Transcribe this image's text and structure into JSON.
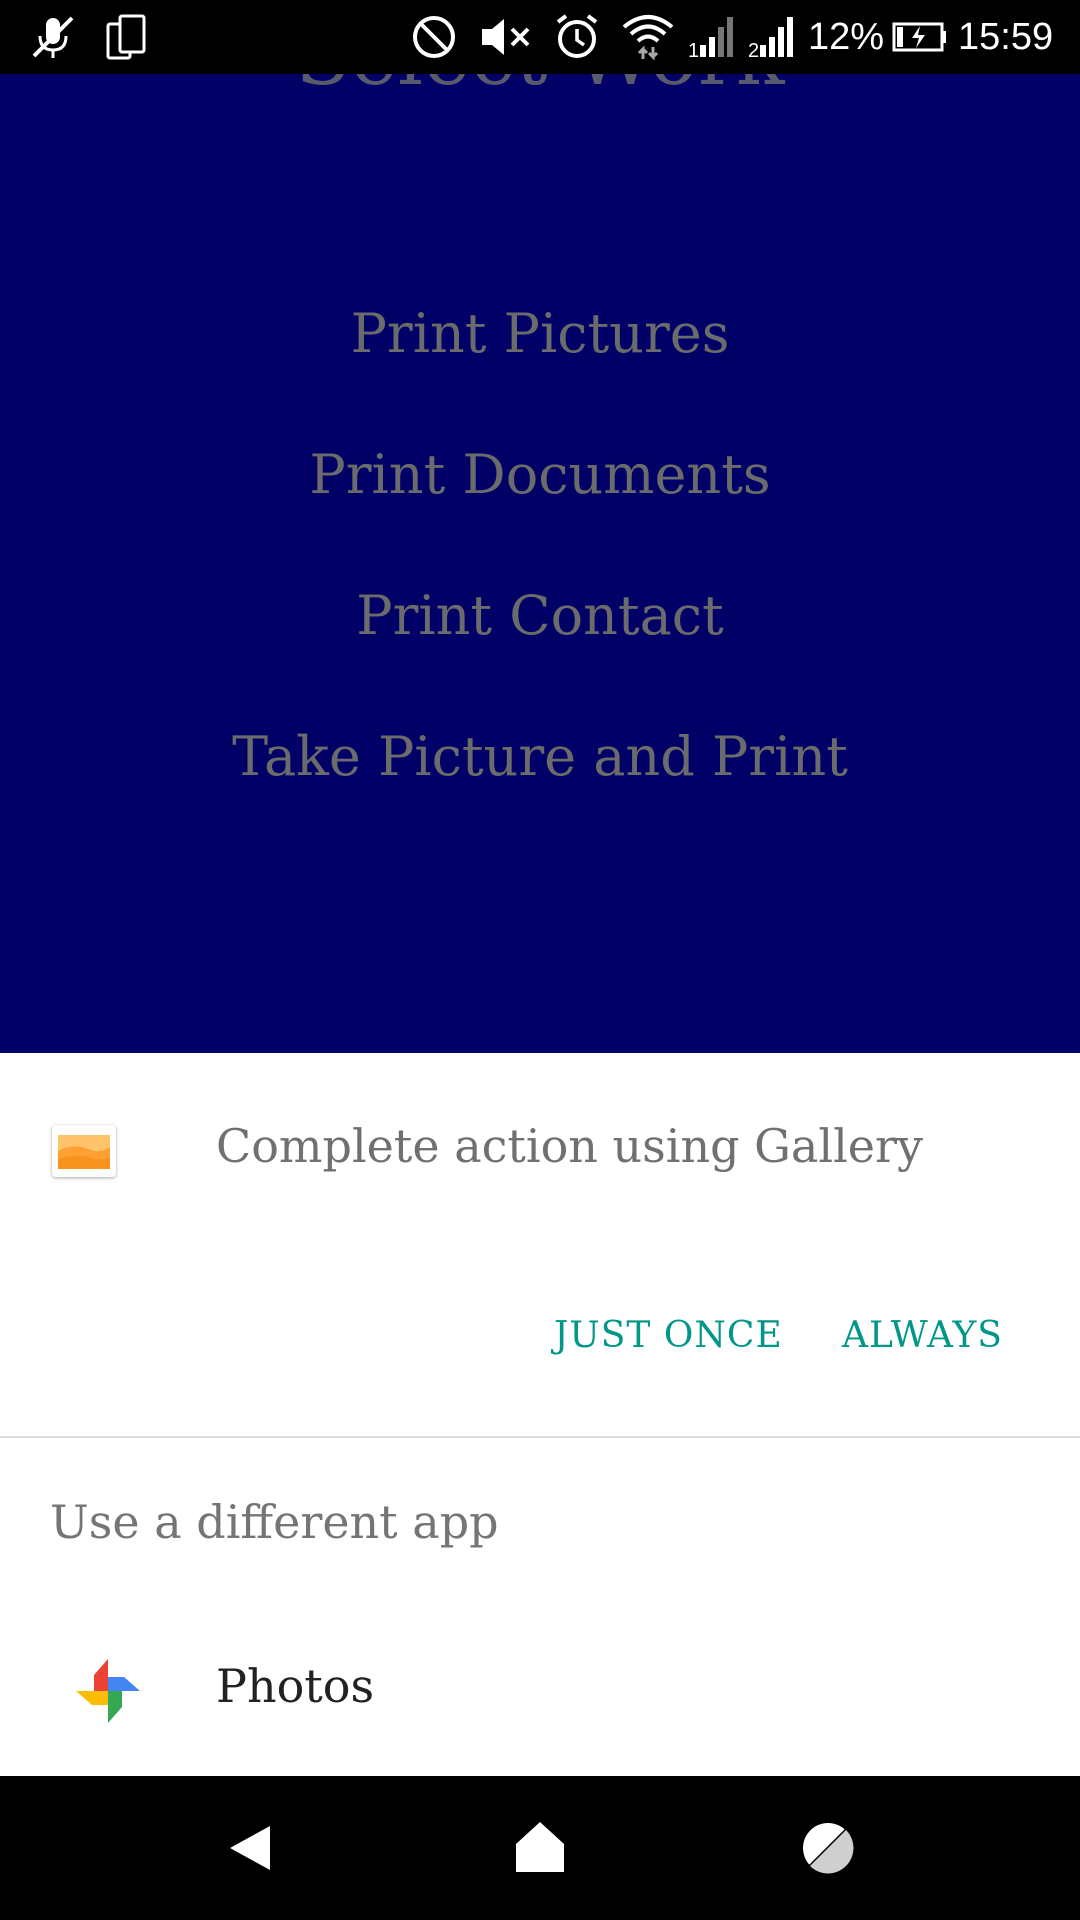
{
  "status_bar": {
    "battery_percent": "12%",
    "time": "15:59",
    "icons": [
      "mute-mic-icon",
      "screen-rotate-icon",
      "do-not-disturb-icon",
      "volume-muted-icon",
      "alarm-icon",
      "wifi-icon",
      "signal-1-icon",
      "signal-2-icon",
      "battery-charging-icon"
    ]
  },
  "app": {
    "title": "Select Work",
    "menu": [
      {
        "label": "Print Pictures"
      },
      {
        "label": "Print Documents"
      },
      {
        "label": "Print Contact"
      },
      {
        "label": "Take Picture and Print"
      }
    ],
    "background_color": "#000066"
  },
  "chooser": {
    "icon": "gallery-icon",
    "title": "Complete action using Gallery",
    "just_once_label": "JUST ONCE",
    "always_label": "ALWAYS",
    "different_app_label": "Use a different app",
    "apps": [
      {
        "label": "Photos",
        "icon": "photos-icon"
      }
    ],
    "accent_color": "#009688"
  },
  "nav_bar": {
    "icons": [
      "back-icon",
      "home-icon",
      "recents-icon"
    ]
  }
}
